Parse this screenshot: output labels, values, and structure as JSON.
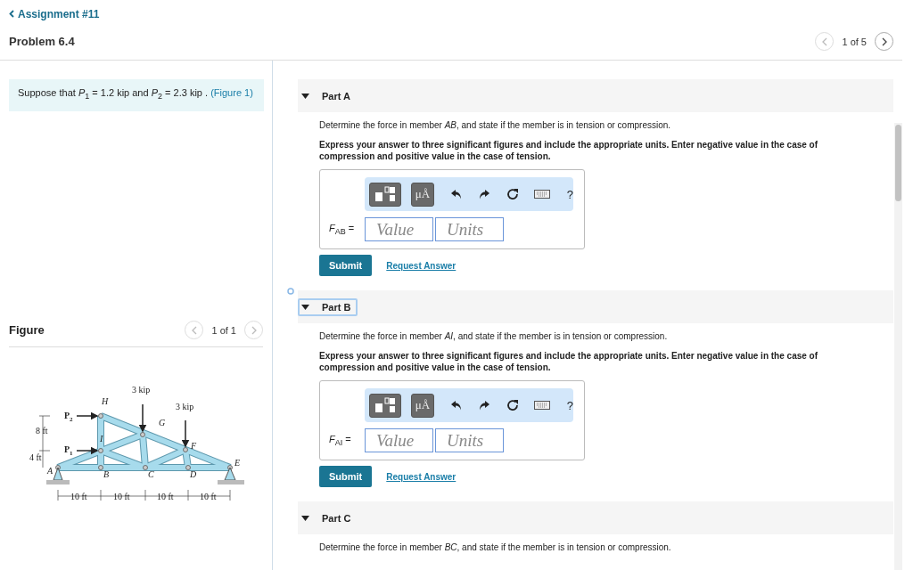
{
  "header": {
    "back_link": "Assignment #11",
    "title": "Problem 6.4",
    "pager": "1 of 5"
  },
  "intro": {
    "text": "Suppose that *P*$_{1}$ = 1.2 kip and *P*$_{2}$ = 2.3 kip . ",
    "link": "(Figure 1)"
  },
  "figure": {
    "title": "Figure",
    "pager": "1 of 1",
    "labels": [
      "3 kip",
      "3 kip",
      "H",
      "G",
      "F",
      "I",
      "E",
      "A",
      "B",
      "C",
      "D",
      "P$_{2}$",
      "P$_{1}$",
      "8 ft",
      "4 ft",
      "10 ft",
      "10 ft",
      "10 ft",
      "10 ft"
    ]
  },
  "parts": [
    {
      "title": "Part A",
      "expanded": true,
      "focused": false,
      "question": "Determine the force in member *AB*, and state if the member is in tension or compression.",
      "instructions": "Express your answer to three significant figures and include the appropriate units. Enter negative value in the case of compression and positive value in the case of tension.",
      "answer": {
        "label": "*F*$_{AB}$ =",
        "symbols": "μÅ",
        "help": "?",
        "value": {
          "placeholder": "Value"
        },
        "units": {
          "placeholder": "Units"
        }
      },
      "submit": "Submit",
      "request": "Request Answer"
    },
    {
      "title": "Part B",
      "expanded": true,
      "focused": true,
      "question": "Determine the force in member *AI*, and state if the member is in tension or compression.",
      "instructions": "Express your answer to three significant figures and include the appropriate units. Enter negative value in the case of compression and positive value in the case of tension.",
      "answer": {
        "label": "*F*$_{AI}$ =",
        "symbols": "μÅ",
        "help": "?",
        "value": {
          "placeholder": "Value"
        },
        "units": {
          "placeholder": "Units"
        }
      },
      "submit": "Submit",
      "request": "Request Answer"
    },
    {
      "title": "Part C",
      "expanded": true,
      "focused": false,
      "question": "Determine the force in member *BC*, and state if the member is in tension or compression."
    }
  ]
}
